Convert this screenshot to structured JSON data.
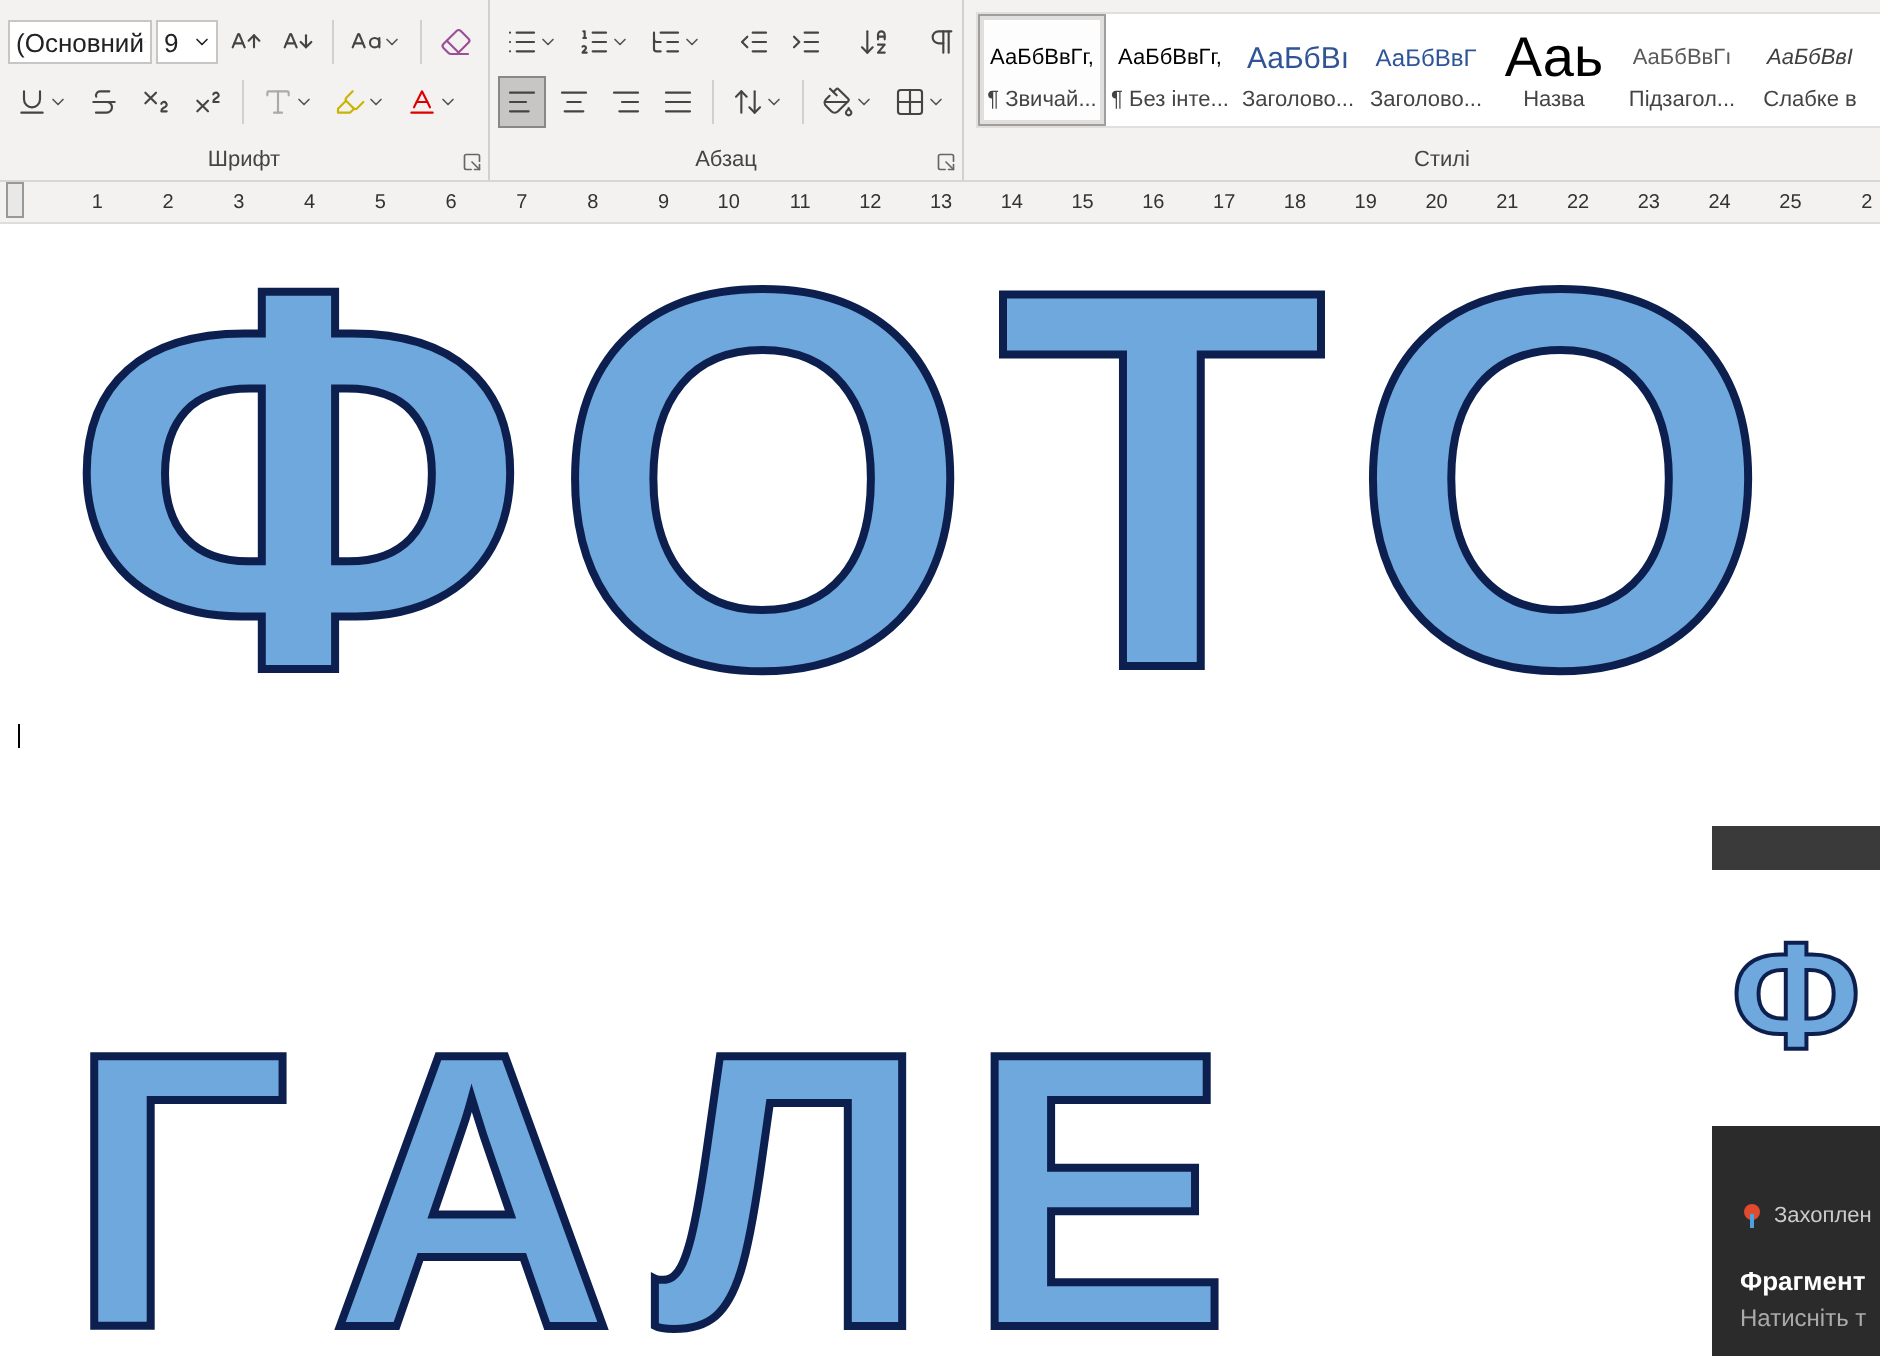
{
  "ribbon": {
    "font_group": {
      "label": "Шрифт",
      "font_name": "(Основний",
      "font_size": "9"
    },
    "paragraph_group": {
      "label": "Абзац",
      "alignments": [
        {
          "kind": "left",
          "selected": true
        },
        {
          "kind": "center",
          "selected": false
        },
        {
          "kind": "right",
          "selected": false
        },
        {
          "kind": "justify",
          "selected": false
        }
      ]
    },
    "styles_group": {
      "label": "Стилі",
      "items": [
        {
          "sample": "АаБбВвГг,",
          "name": "¶ Звичай...",
          "kind": "normal",
          "selected": true
        },
        {
          "sample": "АаБбВвГг,",
          "name": "¶ Без інте...",
          "kind": "normal",
          "selected": false
        },
        {
          "sample": "АаБбВı",
          "name": "Заголово...",
          "kind": "heading1",
          "selected": false
        },
        {
          "sample": "АаБбВвГ",
          "name": "Заголово...",
          "kind": "heading2",
          "selected": false
        },
        {
          "sample": "Ааь",
          "name": "Назва",
          "kind": "title",
          "selected": false
        },
        {
          "sample": "АаБбВвГı",
          "name": "Підзагол...",
          "kind": "subtitle",
          "selected": false
        },
        {
          "sample": "АаБбВвІ",
          "name": "Слабке в",
          "kind": "emphasis",
          "selected": false
        }
      ]
    }
  },
  "ruler": {
    "ticks": [
      "1",
      "2",
      "3",
      "4",
      "5",
      "6",
      "7",
      "8",
      "9",
      "10",
      "11",
      "12",
      "13",
      "14",
      "15",
      "16",
      "17",
      "18",
      "19",
      "20",
      "21",
      "22",
      "23",
      "24",
      "25",
      "2"
    ]
  },
  "document": {
    "lines": [
      "ФОТО",
      "ГАЛЕ"
    ]
  },
  "notification": {
    "thumbnail_text": "Ф",
    "app": "Захоплен",
    "title": "Фрагмент",
    "body": "Натисніть т"
  }
}
